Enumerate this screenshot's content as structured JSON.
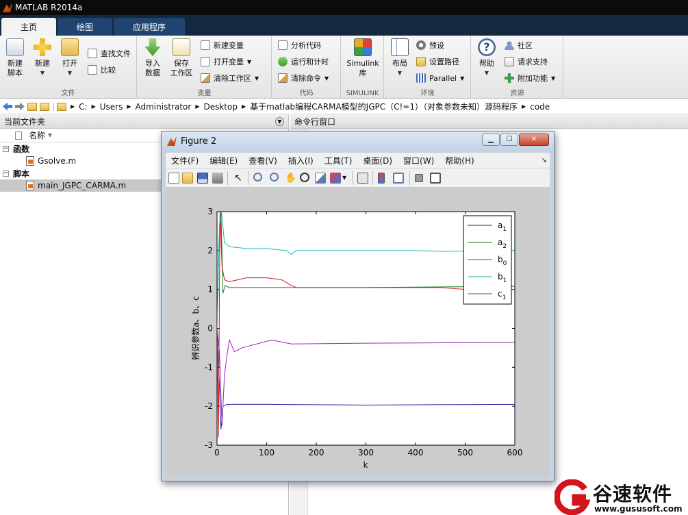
{
  "app": {
    "title": "MATLAB R2014a"
  },
  "tabs": [
    {
      "label": "主页"
    },
    {
      "label": "绘图"
    },
    {
      "label": "应用程序"
    }
  ],
  "ribbon": {
    "file": {
      "label": "文件",
      "new_script": "新建\n脚本",
      "new": "新建",
      "open": "打开",
      "find_files": "查找文件",
      "compare": "比较"
    },
    "variable": {
      "label": "变量",
      "import": "导入\n数据",
      "save_ws": "保存\n工作区",
      "new_var": "新建变量",
      "open_var": "打开变量",
      "clear_ws": "清除工作区"
    },
    "code": {
      "label": "代码",
      "analyze": "分析代码",
      "run_time": "运行和计时",
      "clear_cmd": "清除命令"
    },
    "simulink": {
      "label": "SIMULINK",
      "btn": "Simulink\n库"
    },
    "env": {
      "label": "环境",
      "layout": "布局",
      "prefs": "预设",
      "set_path": "设置路径",
      "parallel": "Parallel"
    },
    "resources": {
      "label": "资源",
      "help": "帮助",
      "community": "社区",
      "support": "请求支持",
      "addons": "附加功能"
    }
  },
  "path": [
    "C:",
    "Users",
    "Administrator",
    "Desktop",
    "基于matlab编程CARMA模型的JGPC（C!=1）（对象参数未知）源码程序",
    "code"
  ],
  "left_panel": {
    "title": "当前文件夹",
    "column": "名称",
    "groups": [
      {
        "name": "函数",
        "files": [
          "Gsolve.m"
        ]
      },
      {
        "name": "脚本",
        "files": [
          "main_JGPC_CARMA.m"
        ]
      }
    ]
  },
  "right_panel": {
    "title": "命令行窗口"
  },
  "figure": {
    "title": "Figure 2",
    "menus": [
      "文件(F)",
      "编辑(E)",
      "查看(V)",
      "插入(I)",
      "工具(T)",
      "桌面(D)",
      "窗口(W)",
      "帮助(H)"
    ]
  },
  "colors": {
    "a1": "#1a1a9a",
    "a2": "#1a7a1a",
    "b0": "#c81e1e",
    "b1": "#22b3b3",
    "c1": "#a020b8"
  },
  "chart_data": {
    "type": "line",
    "title": "",
    "xlabel": "k",
    "ylabel": "辨识参数a、b、c",
    "xlim": [
      0,
      600
    ],
    "ylim": [
      -3,
      3
    ],
    "xticks": [
      0,
      100,
      200,
      300,
      400,
      500,
      600
    ],
    "yticks": [
      -3,
      -2,
      -1,
      0,
      1,
      2,
      3
    ],
    "legend_position": "top-right",
    "series": [
      {
        "name": "a",
        "sub": "1",
        "color_key": "a1",
        "x": [
          0,
          5,
          8,
          12,
          20,
          30,
          100,
          300,
          600
        ],
        "y": [
          0,
          -1.5,
          -2.6,
          -2.0,
          -1.95,
          -1.95,
          -1.95,
          -1.97,
          -1.95
        ]
      },
      {
        "name": "a",
        "sub": "2",
        "color_key": "a2",
        "x": [
          0,
          4,
          8,
          12,
          16,
          25,
          60,
          150,
          300,
          600
        ],
        "y": [
          0,
          2.2,
          3.0,
          0.9,
          1.1,
          1.05,
          1.05,
          1.05,
          1.05,
          1.08
        ]
      },
      {
        "name": "b",
        "sub": "0",
        "color_key": "b0",
        "x": [
          0,
          3,
          6,
          10,
          15,
          25,
          60,
          100,
          130,
          150,
          160,
          300,
          450,
          500,
          600
        ],
        "y": [
          0,
          -2.8,
          3.0,
          1.6,
          1.25,
          1.2,
          1.3,
          1.3,
          1.25,
          1.1,
          1.05,
          1.05,
          1.05,
          1.0,
          1.0
        ]
      },
      {
        "name": "b",
        "sub": "1",
        "color_key": "b1",
        "x": [
          0,
          5,
          9,
          15,
          25,
          60,
          100,
          140,
          150,
          160,
          300,
          400,
          450,
          600
        ],
        "y": [
          0,
          2.7,
          3.0,
          2.2,
          2.1,
          2.05,
          2.05,
          2.0,
          1.9,
          2.0,
          2.0,
          2.0,
          1.98,
          2.0
        ]
      },
      {
        "name": "c",
        "sub": "1",
        "color_key": "c1",
        "x": [
          0,
          5,
          10,
          15,
          20,
          25,
          35,
          50,
          80,
          110,
          150,
          300,
          450,
          600
        ],
        "y": [
          0,
          -0.6,
          -2.5,
          -1.2,
          -0.7,
          -0.3,
          -0.6,
          -0.5,
          -0.4,
          -0.3,
          -0.4,
          -0.38,
          -0.37,
          -0.36
        ]
      }
    ]
  },
  "watermark": {
    "brand": "谷速软件",
    "url": "www.gususoft.com"
  }
}
